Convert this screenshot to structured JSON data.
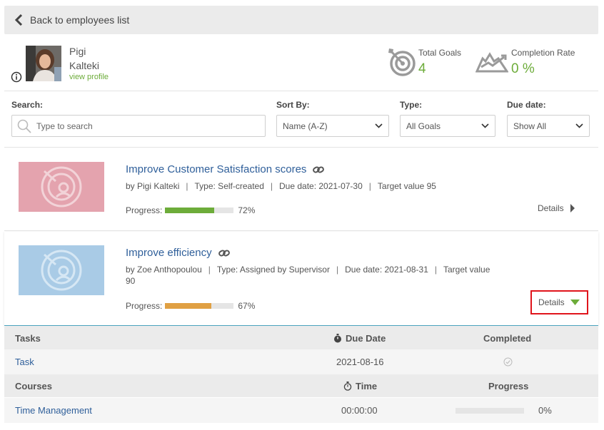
{
  "nav": {
    "back_label": "Back to employees list"
  },
  "profile": {
    "first_name": "Pigi",
    "last_name": "Kalteki",
    "view_profile": "view profile"
  },
  "stats": {
    "total_goals_label": "Total Goals",
    "total_goals_value": "4",
    "completion_rate_label": "Completion Rate",
    "completion_rate_value": "0 %"
  },
  "filters": {
    "search_label": "Search:",
    "search_placeholder": "Type to search",
    "sort_label": "Sort By:",
    "sort_value": "Name (A-Z)",
    "type_label": "Type:",
    "type_value": "All Goals",
    "due_label": "Due date:",
    "due_value": "Show All"
  },
  "goals": [
    {
      "title": "Improve Customer Satisfaction scores",
      "by": "by Pigi Kalteki",
      "type": "Type: Self-created",
      "due": "Due date: 2021-07-30",
      "target": "Target value 95",
      "progress_label": "Progress:",
      "progress_value": 72,
      "progress_text": "72%",
      "details_label": "Details"
    },
    {
      "title": "Improve efficiency",
      "by": "by Zoe Anthopoulou",
      "type": "Type: Assigned by Supervisor",
      "due": "Due date: 2021-08-31",
      "target": "Target value",
      "target_num": "90",
      "progress_label": "Progress:",
      "progress_value": 67,
      "progress_text": "67%",
      "details_label": "Details"
    }
  ],
  "tasks_section": {
    "col_tasks": "Tasks",
    "col_due": "Due Date",
    "col_completed": "Completed",
    "rows": [
      {
        "name": "Task",
        "due": "2021-08-16"
      }
    ]
  },
  "courses_section": {
    "col_courses": "Courses",
    "col_time": "Time",
    "col_progress": "Progress",
    "rows": [
      {
        "name": "Time Management",
        "time": "00:00:00",
        "progress_value": 0,
        "progress_text": "0%"
      }
    ]
  },
  "colors": {
    "green": "#6dac3a",
    "orange": "#e0a043",
    "link_blue": "#2f5f9a",
    "highlight_red": "#e0141b"
  }
}
